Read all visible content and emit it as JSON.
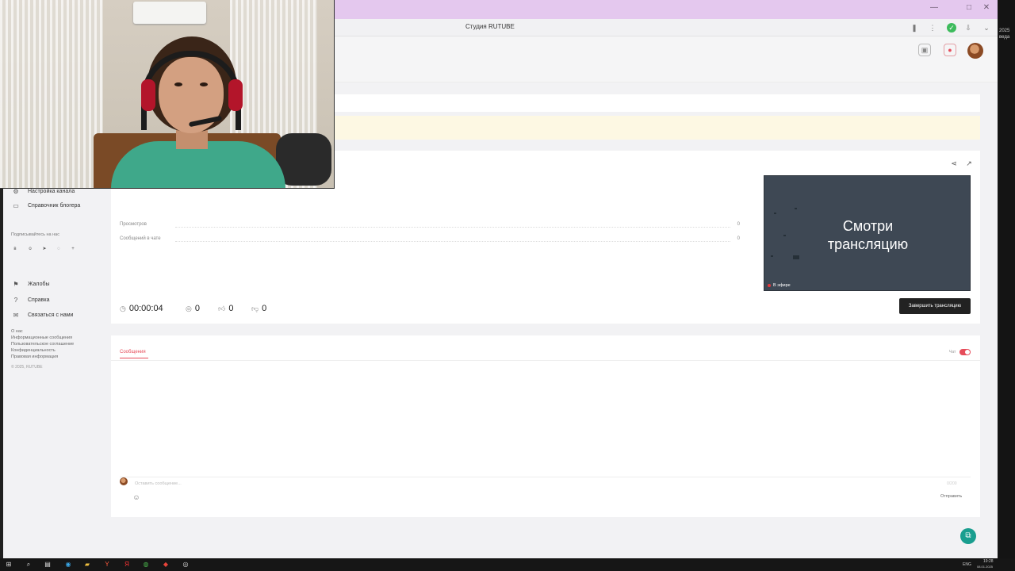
{
  "browser": {
    "page_title": "Студия RUTUBE",
    "window_controls": [
      "—",
      "□",
      "✕"
    ]
  },
  "desktop_right": {
    "texts": [
      "2025",
      "ведa"
    ]
  },
  "sidebar": {
    "items_top": [
      {
        "label": "Настройка канала",
        "icon": "gear-icon"
      },
      {
        "label": "Справочник блогера",
        "icon": "book-icon"
      }
    ],
    "follow_label": "Подписывайтесь на нас",
    "socials": [
      "vk-icon",
      "ok-icon",
      "telegram-icon",
      "viber-icon",
      "plus-icon"
    ],
    "items_bottom": [
      {
        "label": "Жалобы",
        "icon": "flag-icon"
      },
      {
        "label": "Справка",
        "icon": "help-icon"
      },
      {
        "label": "Связаться с нами",
        "icon": "mail-icon"
      }
    ],
    "footer_links": [
      "О нас",
      "Информационные сообщения",
      "Пользовательское соглашение",
      "Конфиденциальность",
      "Правовая информация"
    ],
    "copyright": "© 2025, RUTUBE"
  },
  "stream": {
    "stats": [
      {
        "label": "Просмотров",
        "value": "0"
      },
      {
        "label": "Сообщений в чате",
        "value": "0"
      }
    ],
    "metrics": {
      "duration": "00:00:04",
      "viewers": "0",
      "likes": "0",
      "dislikes": "0"
    },
    "preview_text_line1": "Смотри",
    "preview_text_line2": "трансляцию",
    "live_badge": "В эфире",
    "end_button": "Завершить трансляцию"
  },
  "chat": {
    "tab_label": "Сообщения",
    "toggle_label": "Чат",
    "toggle_on": true,
    "input_placeholder": "Оставить сообщение...",
    "char_count": "0/200",
    "send_label": "Отправить"
  },
  "taskbar": {
    "time": "19:28",
    "date": "08.01.2025",
    "lang": "ENG"
  },
  "colors": {
    "titlebar": "#e4c8ee",
    "accent_red": "#e64c5a",
    "preview_bg": "#3e4854",
    "help_fab": "#1a9e8f",
    "notice_yellow": "#fdf8e3"
  }
}
